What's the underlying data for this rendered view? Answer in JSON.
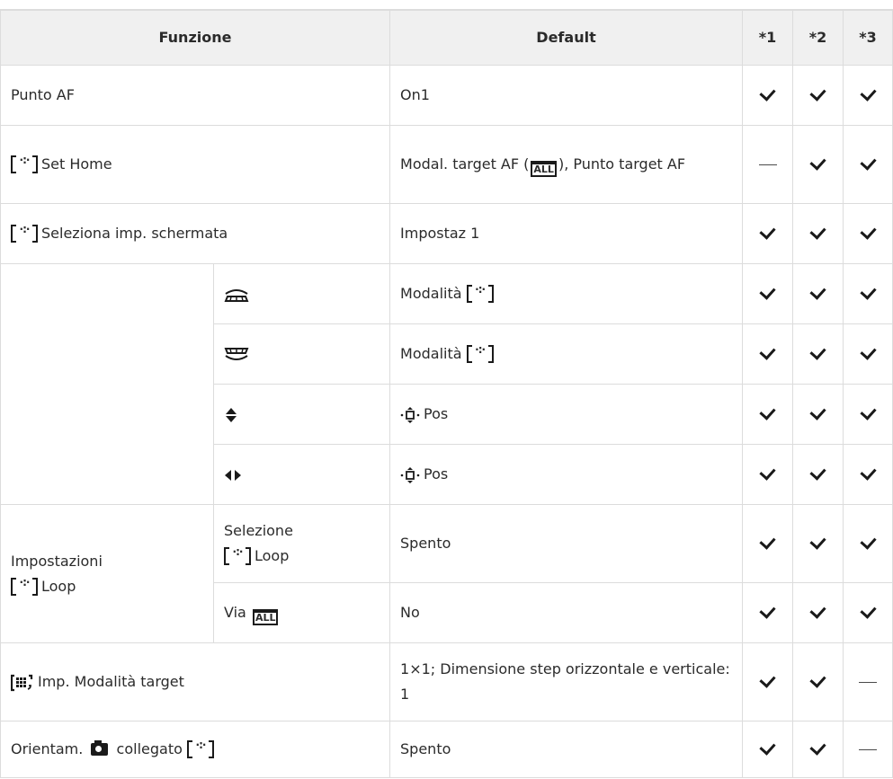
{
  "header": {
    "funzione": "Funzione",
    "default": "Default",
    "col1": "*1",
    "col2": "*2",
    "col3": "*3"
  },
  "rows": {
    "punto_af": {
      "label": "Punto AF",
      "default": "On1"
    },
    "set_home": {
      "label": "Set Home",
      "default_a": "Modal. target AF (",
      "default_b": "), Punto target AF"
    },
    "seleziona": {
      "label": "Seleziona imp. schermata",
      "default": "Impostaz 1"
    },
    "dial_front": {
      "default": "Modalità"
    },
    "dial_rear": {
      "default": "Modalità"
    },
    "updown": {
      "default": "Pos"
    },
    "leftright": {
      "default": "Pos"
    },
    "impostazioni": {
      "label_a": "Impostazioni",
      "label_b": "Loop"
    },
    "selezione_loop": {
      "label_a": "Selezione",
      "label_b": "Loop",
      "default": "Spento"
    },
    "via_all": {
      "label": "Via",
      "default": "No"
    },
    "imp_modalita": {
      "label": "Imp. Modalità target",
      "default": "1×1; Dimensione step orizzontale e verticale: 1"
    },
    "orientam": {
      "label_a": "Orientam.",
      "label_b": "collegato",
      "default": "Spento"
    }
  },
  "icons": {
    "check": "check-icon",
    "dash": "dash-icon",
    "frame": "af-target-frame-icon",
    "all": "all-target-icon",
    "camera": "camera-icon",
    "front_dial": "front-dial-icon",
    "rear_dial": "rear-dial-icon",
    "up_down": "up-down-arrow-icon",
    "left_right": "left-right-arrow-icon",
    "grid": "custom-target-grid-icon"
  },
  "marks_legend": {
    "check": "✓",
    "dash": "—"
  },
  "colors": {
    "header_bg": "#f0f0f0",
    "border": "#dcdcdc",
    "text": "#2b2b2b"
  },
  "icon_text": {
    "all": "ALL",
    "dots": "·:·",
    "grid": "⁝⁞",
    "up_down": "◆",
    "left_right": "◂▸",
    "pos_arrow": "·⬘·"
  }
}
